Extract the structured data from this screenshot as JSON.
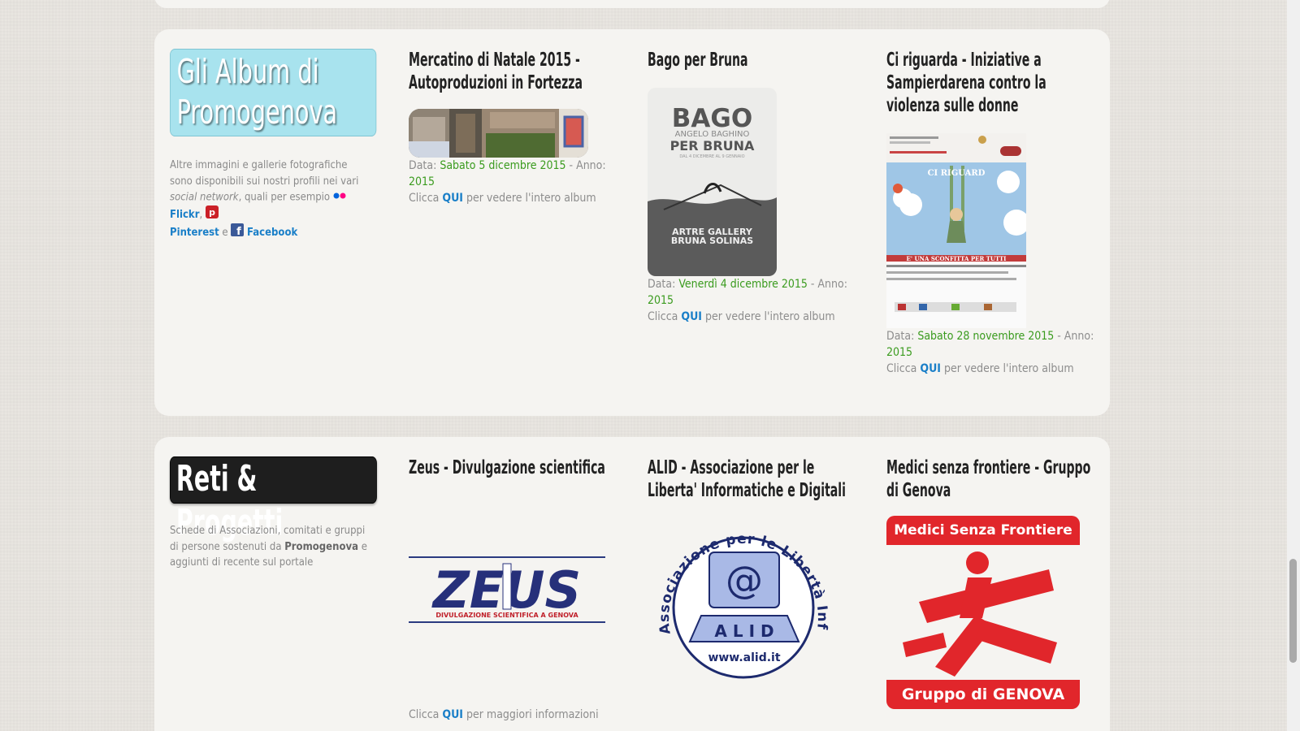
{
  "albums": {
    "heading": "Gli Album di Promogenova",
    "desc_before": "Altre immagini e gallerie fotografiche sono disponibili sui nostri profili nei vari social ",
    "desc_italic": "social network",
    "desc_after": ", quali per esempio ",
    "flickr": "Flickr",
    "comma": ",",
    "pinterest": "Pinterest",
    "and": " e ",
    "facebook": "Facebook",
    "items": [
      {
        "title": "Mercatino di Natale 2015 - Autoproduzioni in Fortezza",
        "date_label": "Data: ",
        "date": "Sabato 5 dicembre 2015",
        "year_label": " - Anno: ",
        "year": "2015",
        "click": "Clicca ",
        "qui": "QUI",
        "click_after": " per vedere l'intero album"
      },
      {
        "title": "Bago per Bruna",
        "poster_title": "BAGO",
        "poster_sub": "ANGELO BAGHINO",
        "poster_per": "PER BRUNA",
        "poster_dates": "DAL 4 DICEMBRE AL 9 GENNAIO",
        "poster_gallery": "ARTRE GALLERY",
        "poster_name": "BRUNA SOLINAS",
        "date_label": "Data: ",
        "date": "Venerdì 4 dicembre 2015",
        "year_label": " - Anno: ",
        "year": "2015",
        "click": "Clicca ",
        "qui": "QUI",
        "click_after": " per vedere l'intero album"
      },
      {
        "title": "Ci riguarda - Iniziative a Sampierdarena contro la violenza sulle donne",
        "poster_title": "CI RIGUARD",
        "poster_footer": "E' UNA SCONFITTA PER TUTTI",
        "date_label": "Data: ",
        "date": "Sabato 28 novembre 2015",
        "year_label": " - Anno: ",
        "year": "2015",
        "click": "Clicca ",
        "qui": "QUI",
        "click_after": " per vedere l'intero album"
      }
    ]
  },
  "reti": {
    "heading": "Reti & Progetti",
    "desc_before": "Schede di Associazioni, comitati e gruppi di persone sostenuti da ",
    "desc_bold": "Promogenova",
    "desc_after": " e aggiunti di recente sul portale",
    "items": [
      {
        "title": "Zeus - Divulgazione scientifica",
        "logo_text": "ZEUS",
        "logo_sub": "DIVULGAZIONE SCIENTIFICA A GENOVA",
        "click": "Clicca ",
        "qui": "QUI",
        "click_after": " per maggiori informazioni"
      },
      {
        "title": "ALID - Associazione per le Liberta' Informatiche e Digitali",
        "logo_ring": "Associazione per le Libertà Informatiche e Digitali",
        "logo_at": "@",
        "logo_name": "A L I D",
        "logo_url": "www.alid.it"
      },
      {
        "title": "Medici senza frontiere - Gruppo di Genova",
        "logo_top": "Medici Senza Frontiere",
        "logo_bottom": "Gruppo di GENOVA"
      }
    ]
  },
  "colors": {
    "accent_blue": "#1a7fc8",
    "accent_green": "#3a9b1e",
    "msf_red": "#e1262b"
  }
}
